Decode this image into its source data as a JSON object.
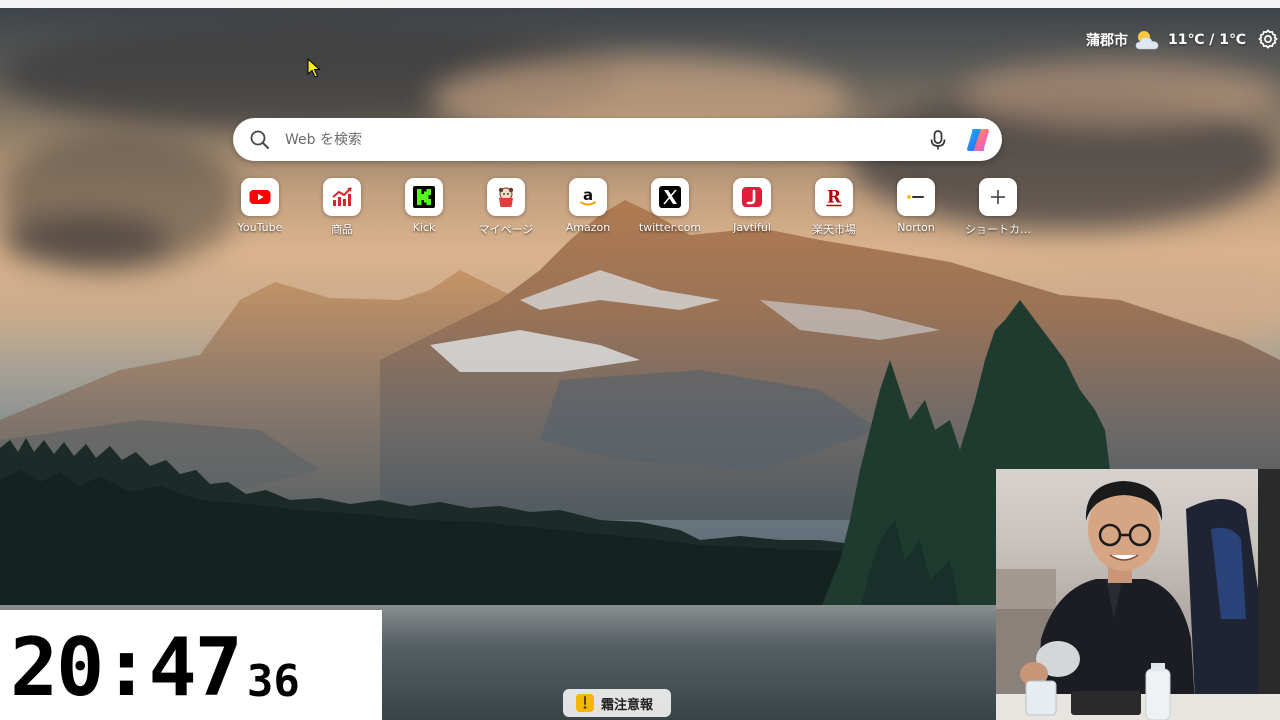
{
  "weather": {
    "city": "蒲郡市",
    "temperature": "11℃ / 1℃",
    "icon": "partly-cloudy-icon"
  },
  "settings": {
    "icon": "gear-icon"
  },
  "search": {
    "placeholder": "Web を検索",
    "icons": [
      "search-icon",
      "microphone-icon",
      "copilot-icon"
    ]
  },
  "shortcuts": [
    {
      "label": "YouTube",
      "icon": "youtube-icon"
    },
    {
      "label": "商品",
      "icon": "chart-icon"
    },
    {
      "label": "Kick",
      "icon": "kick-icon"
    },
    {
      "label": "マイページ",
      "icon": "mypage-icon"
    },
    {
      "label": "Amazon",
      "icon": "amazon-icon"
    },
    {
      "label": "twitter.com",
      "icon": "x-icon"
    },
    {
      "label": "Javtiful",
      "icon": "javtiful-icon"
    },
    {
      "label": "楽天市場",
      "icon": "rakuten-icon"
    },
    {
      "label": "Norton",
      "icon": "norton-icon"
    },
    {
      "label": "ショートカ…",
      "icon": "plus-icon"
    }
  ],
  "clock": {
    "hours_minutes": "20:47",
    "seconds": "36"
  },
  "alert": {
    "label": "霜注意報",
    "icon": "warning-icon"
  },
  "colors": {
    "youtube": "#ff0000",
    "kick": "#53fc18",
    "rakuten": "#bf0000",
    "copilot_blue": "#2b7bff",
    "copilot_pink": "#ff5f8a"
  }
}
